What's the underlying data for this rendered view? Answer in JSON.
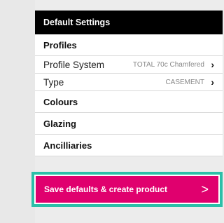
{
  "panel": {
    "title": "Default Settings",
    "sections": {
      "profiles": "Profiles",
      "colours": "Colours",
      "glazing": "Glazing",
      "ancillaries": "Ancilliaries"
    },
    "settings": [
      {
        "label": "Profile System",
        "value": "TOTAL 70c Chamfered"
      },
      {
        "label": "Type",
        "value": "CASEMENT"
      }
    ],
    "cta": {
      "label": "Save defaults & create product"
    }
  },
  "icons": {
    "setting_chevron": "chevron-right-icon",
    "cta_arrow": "chevron-right-icon"
  },
  "colors": {
    "header_bg": "#000000",
    "cta_bg": "#e0006e",
    "focus_ring": "#2bbfa8"
  }
}
